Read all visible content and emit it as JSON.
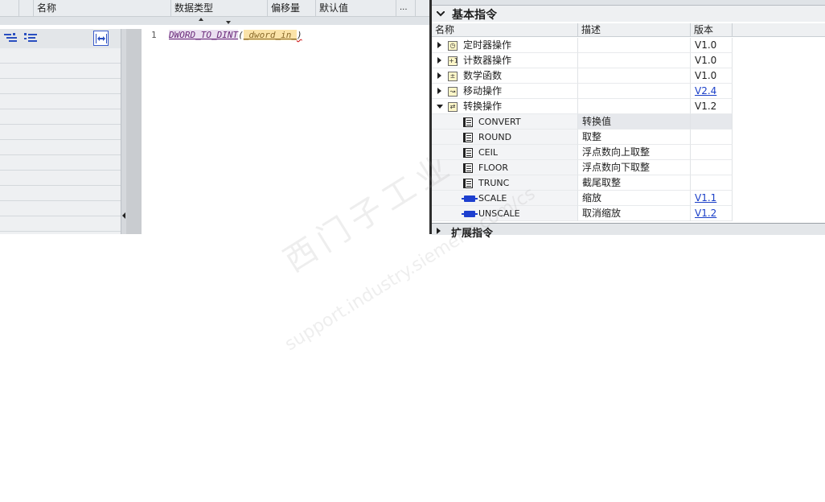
{
  "interface_table": {
    "columns": [
      "名称",
      "数据类型",
      "偏移量",
      "默认值",
      "..."
    ]
  },
  "editor": {
    "line_number": "1",
    "code_function": "DWORD_TO_DINT",
    "code_open": "(",
    "code_param": "_dword_in_",
    "code_close": ")"
  },
  "instructions_panel": {
    "title": "基本指令",
    "columns": {
      "name": "名称",
      "description": "描述",
      "version": "版本"
    },
    "categories": [
      {
        "label": "定时器操作",
        "version": "V1.0",
        "icon": "timer-icon",
        "icon_glyph": "◷"
      },
      {
        "label": "计数器操作",
        "version": "V1.0",
        "icon": "counter-icon",
        "icon_glyph": "+1"
      },
      {
        "label": "数学函数",
        "version": "V1.0",
        "icon": "math-icon",
        "icon_glyph": "±"
      },
      {
        "label": "移动操作",
        "version": "V2.4",
        "icon": "move-icon",
        "icon_glyph": "↝"
      },
      {
        "label": "转换操作",
        "version": "V1.2",
        "icon": "convert-icon",
        "icon_glyph": "⇄"
      }
    ],
    "conversion_items": [
      {
        "name": "CONVERT",
        "description": "转换值",
        "version": ""
      },
      {
        "name": "ROUND",
        "description": "取整",
        "version": ""
      },
      {
        "name": "CEIL",
        "description": "浮点数向上取整",
        "version": ""
      },
      {
        "name": "FLOOR",
        "description": "浮点数向下取整",
        "version": ""
      },
      {
        "name": "TRUNC",
        "description": "截尾取整",
        "version": ""
      },
      {
        "name": "SCALE",
        "description": "缩放",
        "version": "V1.1"
      },
      {
        "name": "UNSCALE",
        "description": "取消缩放",
        "version": "V1.2"
      }
    ],
    "next_section": "扩展指令"
  },
  "watermark": {
    "line1": "西门子工业",
    "line2": "support.industry.siemens.com/cs"
  },
  "colors": {
    "accent_link": "#1a3fc8",
    "function_name": "#6a2a7a",
    "param_highlight": "#fbe3a8"
  }
}
